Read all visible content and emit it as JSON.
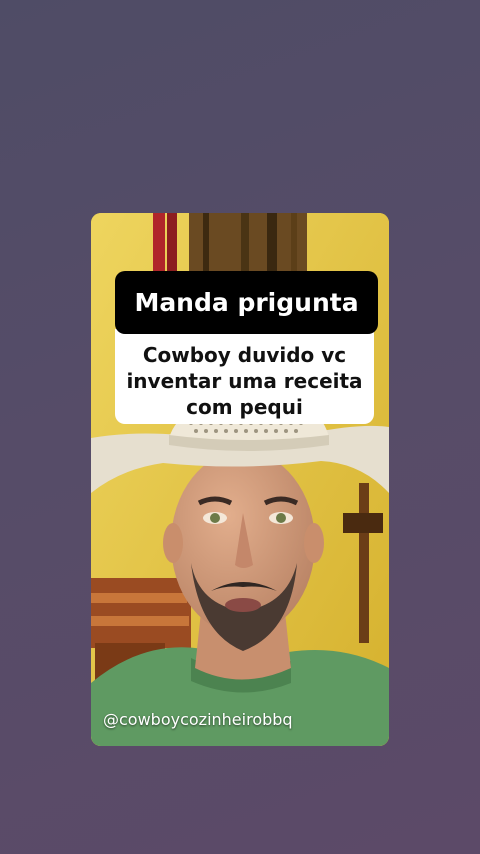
{
  "story": {
    "question_header": "Manda prigunta",
    "question_text": "Cowboy duvido vc inventar uma receita com pequi",
    "handle": "@cowboycozinheirobbq"
  }
}
